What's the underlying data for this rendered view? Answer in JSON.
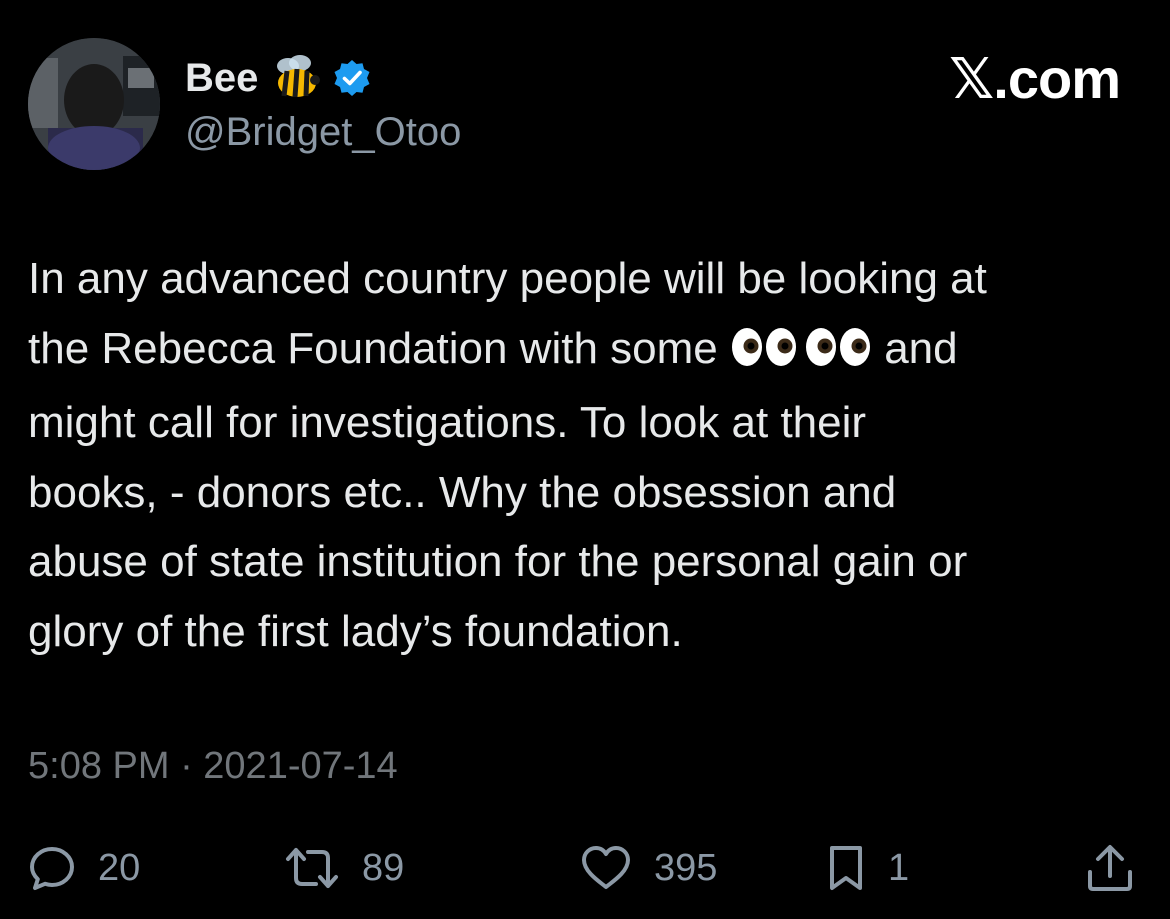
{
  "author": {
    "display_name": "Bee",
    "handle": "@Bridget_Otoo",
    "emoji_icon": "bee-emoji",
    "verified_icon": "verified-badge-icon"
  },
  "brand": "𝕏.com",
  "tweet": {
    "line1": "In any advanced country people will be looking at",
    "line2_before": "the Rebecca Foundation with some",
    "line2_after": "and",
    "line3": "might call for investigations. To look at their",
    "line4": "books, - donors etc.. Why the obsession and",
    "line5": "abuse of state institution for the personal gain or",
    "line6": "glory of the first lady’s foundation.",
    "inline_emoji": "eyes-emoji"
  },
  "timestamp": "5:08 PM · 2021-07-14",
  "actions": {
    "reply_count": "20",
    "retweet_count": "89",
    "like_count": "395",
    "bookmark_count": "1"
  },
  "colors": {
    "background": "#000000",
    "text": "#e7e9ea",
    "muted": "#8b98a5",
    "timestamp": "#71767b",
    "verified": "#1d9bf0"
  }
}
